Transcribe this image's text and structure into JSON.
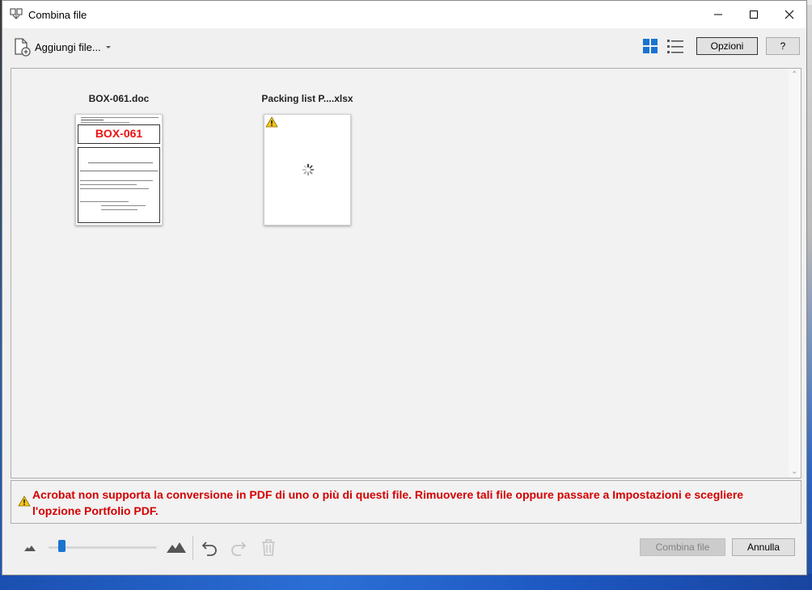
{
  "window": {
    "title": "Combina file",
    "title_icon": "combine-files-icon",
    "controls": [
      "minimize-icon",
      "maximize-icon",
      "close-icon"
    ]
  },
  "toolbar": {
    "add_files_label": "Aggiungi file...",
    "add_files_icon": "add-file-icon",
    "view_thumbnails_icon": "grid-view-icon",
    "view_list_icon": "list-view-icon",
    "options_label": "Opzioni",
    "help_label": "?"
  },
  "files": [
    {
      "name": "BOX-061.doc",
      "preview_title": "BOX-061",
      "status": "converted"
    },
    {
      "name": "Packing list P....xlsx",
      "status": "warning-loading",
      "icons": [
        "warning-icon",
        "loading-spinner-icon"
      ]
    }
  ],
  "warning": {
    "icon": "warning-icon",
    "text": "Acrobat non supporta la conversione in PDF di uno o più di questi file. Rimuovere tali file oppure passare a Impostazioni e scegliere l'opzione Portfolio PDF."
  },
  "footer": {
    "zoom_out_icon": "small-mountain-icon",
    "zoom_in_icon": "large-mountain-icon",
    "undo_icon": "undo-icon",
    "redo_icon": "redo-icon",
    "delete_icon": "trash-icon",
    "combine_label": "Combina file",
    "cancel_label": "Annulla",
    "zoom_level": 0.12
  },
  "colors": {
    "warning_text": "#d40000",
    "accent": "#1a73d1"
  }
}
